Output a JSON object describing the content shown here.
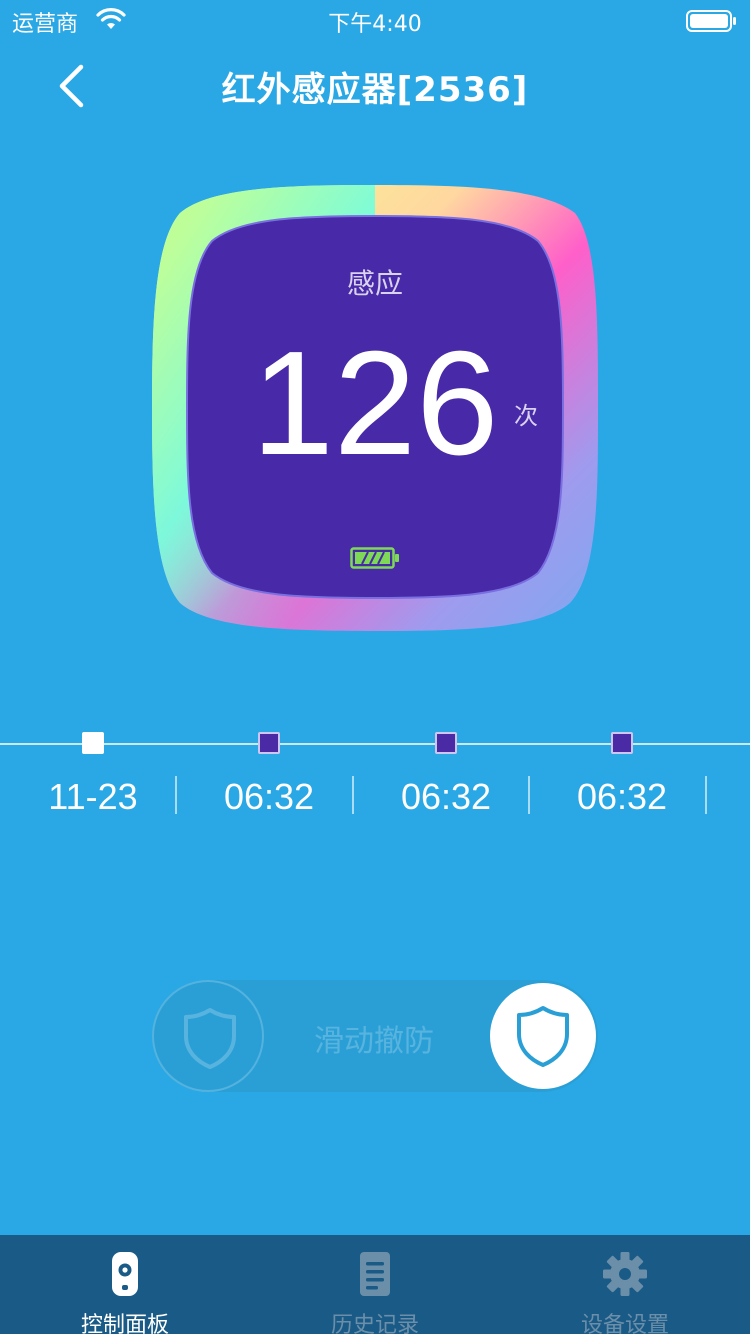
{
  "status_bar": {
    "carrier": "运营商",
    "time": "下午4:40"
  },
  "nav": {
    "title": "红外感应器[2536]"
  },
  "sensor": {
    "label": "感应",
    "count": "126",
    "unit": "次",
    "battery_level": 1.0
  },
  "timeline": {
    "labels": [
      "11-23",
      "06:32",
      "06:32",
      "06:32"
    ]
  },
  "slider": {
    "label": "滑动撤防"
  },
  "tabs": [
    {
      "label": "控制面板",
      "icon": "remote-icon",
      "active": true
    },
    {
      "label": "历史记录",
      "icon": "document-icon",
      "active": false
    },
    {
      "label": "设备设置",
      "icon": "gear-icon",
      "active": false
    }
  ],
  "colors": {
    "background": "#29a8e5",
    "gauge_fill": "#4829a8",
    "event_marker": "#4b2aa6",
    "battery": "#7ed957",
    "tab_bar": "#1a5a86"
  }
}
